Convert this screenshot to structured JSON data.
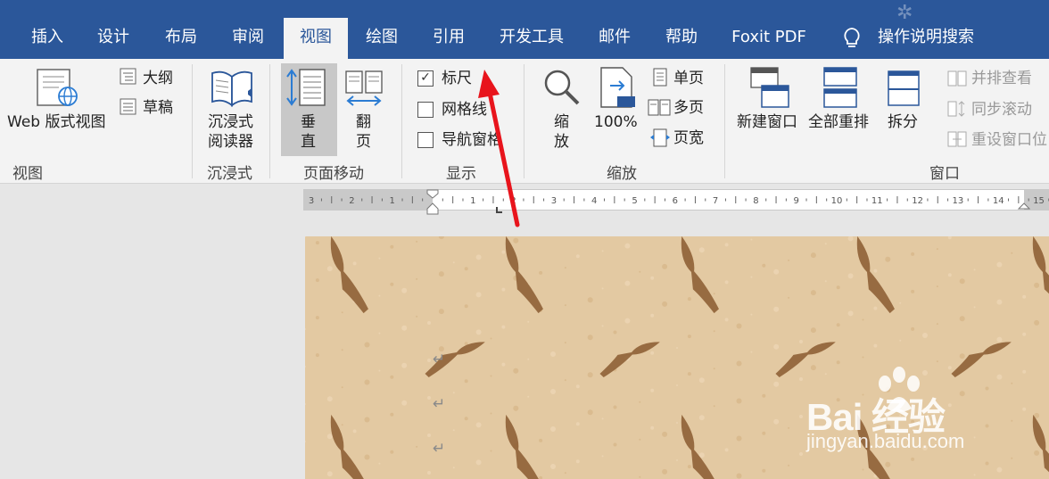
{
  "tabs": [
    {
      "label": "插入",
      "active": false
    },
    {
      "label": "设计",
      "active": false
    },
    {
      "label": "布局",
      "active": false
    },
    {
      "label": "审阅",
      "active": false
    },
    {
      "label": "视图",
      "active": true
    },
    {
      "label": "绘图",
      "active": false
    },
    {
      "label": "引用",
      "active": false
    },
    {
      "label": "开发工具",
      "active": false
    },
    {
      "label": "邮件",
      "active": false
    },
    {
      "label": "帮助",
      "active": false
    },
    {
      "label": "Foxit PDF",
      "active": false
    }
  ],
  "tell_me": {
    "label": "操作说明搜索",
    "icon": "lightbulb-icon"
  },
  "ribbon": {
    "views": {
      "group_label": "视图",
      "web_layout": "Web 版式视图",
      "outline": "大纲",
      "draft": "草稿"
    },
    "immersive": {
      "group_label": "沉浸式",
      "reader_line1": "沉浸式",
      "reader_line2": "阅读器"
    },
    "page_movement": {
      "group_label": "页面移动",
      "vertical_1": "垂",
      "vertical_2": "直",
      "flip_1": "翻",
      "flip_2": "页"
    },
    "show": {
      "group_label": "显示",
      "ruler": {
        "label": "标尺",
        "checked": true
      },
      "gridlines": {
        "label": "网格线",
        "checked": false
      },
      "nav_pane": {
        "label": "导航窗格",
        "checked": false
      }
    },
    "zoom": {
      "group_label": "缩放",
      "zoom_1": "缩",
      "zoom_2": "放",
      "hundred": "100%",
      "one_page": "单页",
      "multi_page": "多页",
      "page_width": "页宽"
    },
    "window": {
      "group_label": "窗口",
      "new_window": "新建窗口",
      "arrange_all": "全部重排",
      "split": "拆分",
      "side_by_side": "并排查看",
      "sync_scroll": "同步滚动",
      "reset_position": "重设窗口位"
    }
  },
  "ruler_labels": [
    "3",
    "2",
    "1",
    "1",
    "2",
    "3",
    "4",
    "5",
    "6",
    "7",
    "8",
    "9",
    "10",
    "11",
    "12",
    "13",
    "14",
    "15"
  ],
  "paragraph_mark": "↵",
  "watermark": {
    "brand": "Bai 经验",
    "url": "jingyan.baidu.com"
  },
  "colors": {
    "tab_bar": "#2b579a",
    "ribbon": "#f3f3f3",
    "annotation_arrow": "#e8141c",
    "page_bg": "#e3c9a2"
  }
}
